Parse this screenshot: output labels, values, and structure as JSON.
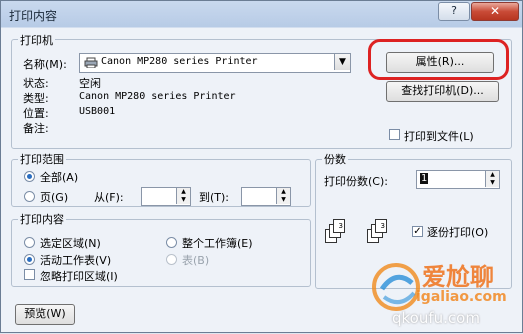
{
  "window": {
    "title": "打印内容",
    "help_label": "?",
    "close_label": "✕"
  },
  "printer": {
    "group_label": "打印机",
    "name_label": "名称(M):",
    "name_value": "Canon MP280 series Printer",
    "status_label": "状态:",
    "status_value": "空闲",
    "type_label": "类型:",
    "type_value": "Canon MP280 series Printer",
    "location_label": "位置:",
    "location_value": "USB001",
    "comment_label": "备注:",
    "properties_button": "属性(R)...",
    "find_button": "查找打印机(D)...",
    "print_to_file": "打印到文件(L)"
  },
  "range": {
    "group_label": "打印范围",
    "all": "全部(A)",
    "pages": "页(G)",
    "from_label": "从(F):",
    "to_label": "到(T):"
  },
  "copies": {
    "group_label": "份数",
    "count_label": "打印份数(C):",
    "count_value": "1",
    "collate": "逐份打印(O)"
  },
  "content": {
    "group_label": "打印内容",
    "selection": "选定区域(N)",
    "entire_workbook": "整个工作簿(E)",
    "active_sheets": "活动工作表(V)",
    "table": "表(B)",
    "ignore_print_area": "忽略打印区域(I)"
  },
  "preview_button": "预览(W)",
  "watermark": {
    "line1": "爱尬聊",
    "line2": "igaliao.com",
    "line3": "qkoufu.com"
  },
  "colors": {
    "highlight": "#dd2222",
    "accent": "#2a6dc0"
  }
}
